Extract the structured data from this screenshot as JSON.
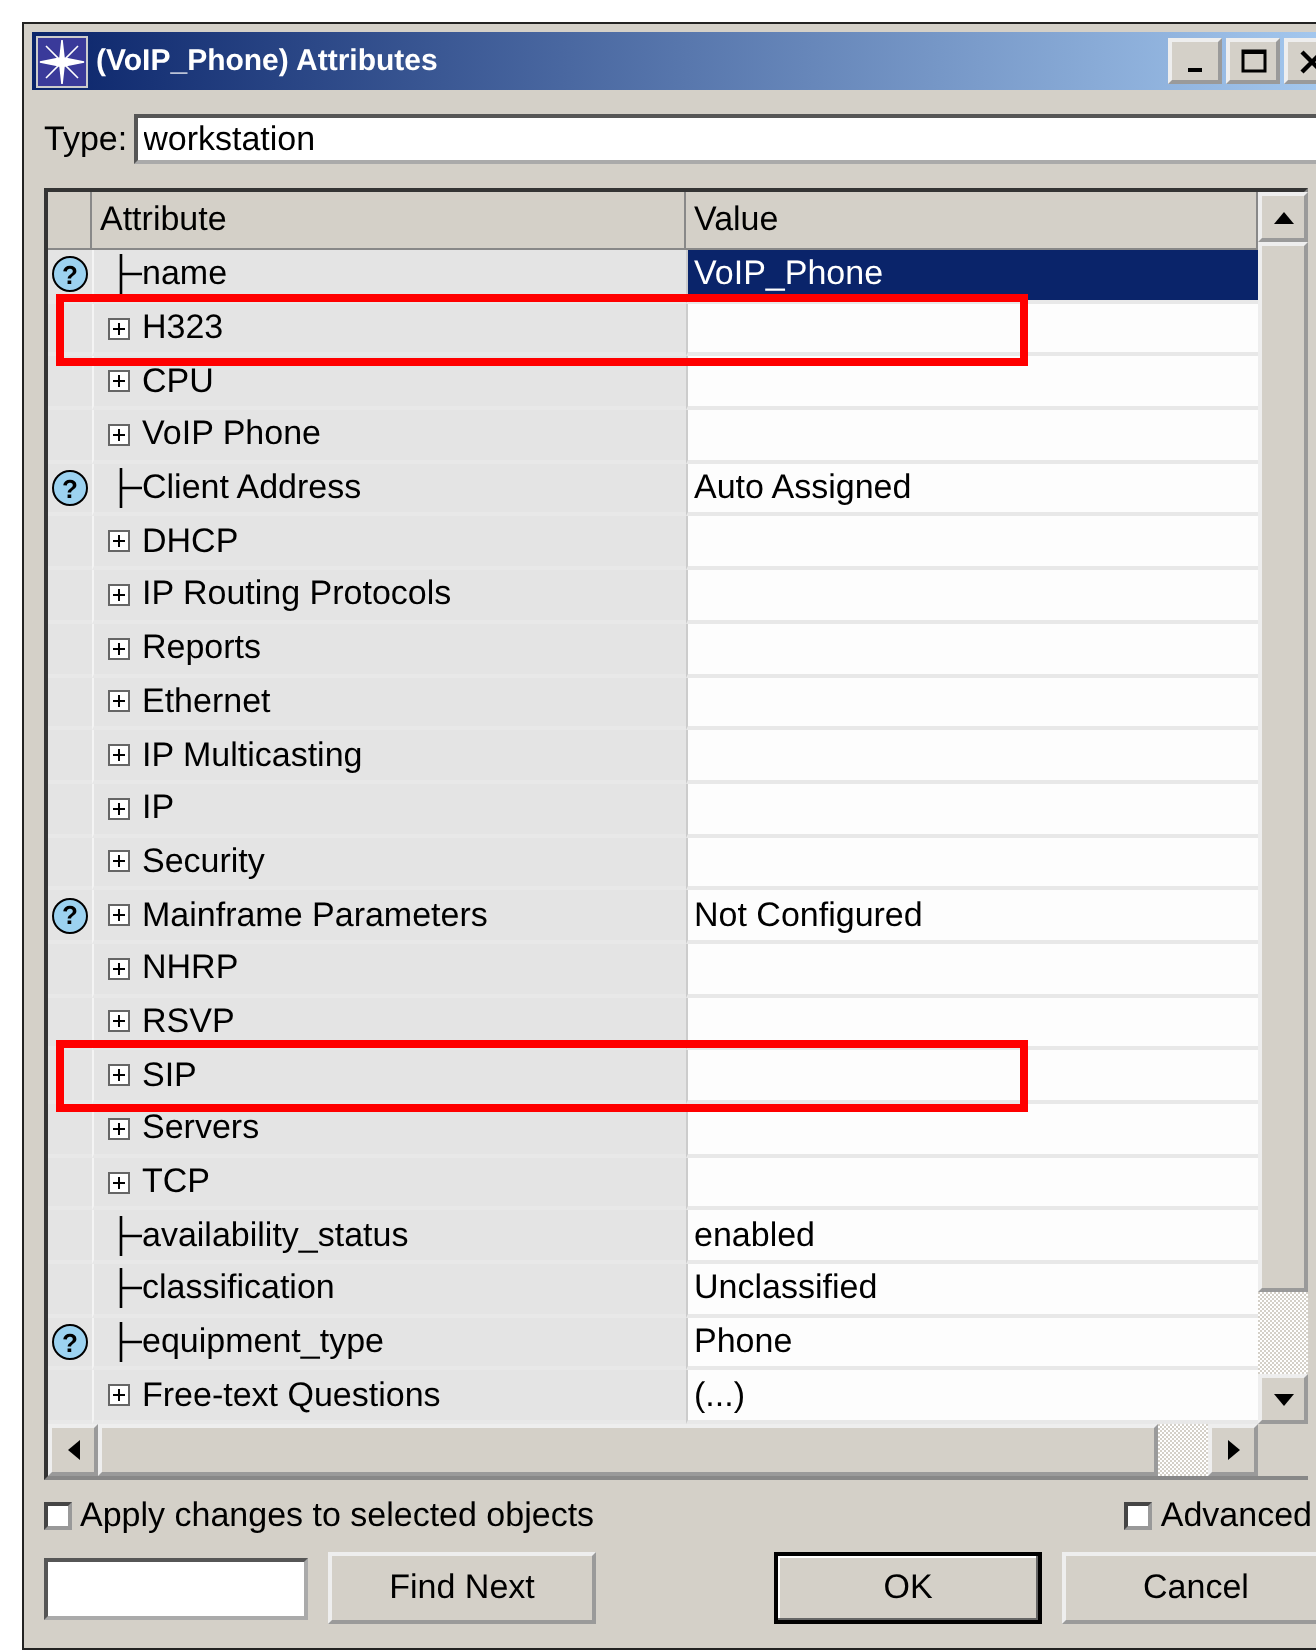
{
  "window": {
    "title": "(VoIP_Phone) Attributes"
  },
  "type_field": {
    "label": "Type:",
    "value": "workstation"
  },
  "table": {
    "columns": [
      "Attribute",
      "Value"
    ],
    "rows": [
      {
        "kind": "leaf",
        "help": "?",
        "attribute": "name",
        "value": "VoIP_Phone",
        "selected": true,
        "highlighted": false
      },
      {
        "kind": "group",
        "attribute": "H323",
        "value": "",
        "selected": false,
        "highlighted": true
      },
      {
        "kind": "group",
        "attribute": "CPU",
        "value": "",
        "selected": false,
        "highlighted": false
      },
      {
        "kind": "group",
        "attribute": "VoIP Phone",
        "value": "",
        "selected": false,
        "highlighted": false
      },
      {
        "kind": "leaf",
        "help": "?",
        "attribute": "Client Address",
        "value": "Auto Assigned",
        "selected": false,
        "highlighted": false
      },
      {
        "kind": "group",
        "attribute": "DHCP",
        "value": "",
        "selected": false,
        "highlighted": false
      },
      {
        "kind": "group",
        "attribute": "IP Routing Protocols",
        "value": "",
        "selected": false,
        "highlighted": false
      },
      {
        "kind": "group",
        "attribute": "Reports",
        "value": "",
        "selected": false,
        "highlighted": false
      },
      {
        "kind": "group",
        "attribute": "Ethernet",
        "value": "",
        "selected": false,
        "highlighted": false
      },
      {
        "kind": "group",
        "attribute": "IP Multicasting",
        "value": "",
        "selected": false,
        "highlighted": false
      },
      {
        "kind": "group",
        "attribute": "IP",
        "value": "",
        "selected": false,
        "highlighted": false
      },
      {
        "kind": "group",
        "attribute": "Security",
        "value": "",
        "selected": false,
        "highlighted": false
      },
      {
        "kind": "group",
        "help": "?",
        "attribute": "Mainframe Parameters",
        "value": "Not Configured",
        "selected": false,
        "highlighted": false
      },
      {
        "kind": "group",
        "attribute": "NHRP",
        "value": "",
        "selected": false,
        "highlighted": false
      },
      {
        "kind": "group",
        "attribute": "RSVP",
        "value": "",
        "selected": false,
        "highlighted": false
      },
      {
        "kind": "group",
        "attribute": "SIP",
        "value": "",
        "selected": false,
        "highlighted": true
      },
      {
        "kind": "group",
        "attribute": "Servers",
        "value": "",
        "selected": false,
        "highlighted": false
      },
      {
        "kind": "group",
        "attribute": "TCP",
        "value": "",
        "selected": false,
        "highlighted": false
      },
      {
        "kind": "leaf",
        "attribute": "availability_status",
        "value": "enabled",
        "selected": false,
        "highlighted": false
      },
      {
        "kind": "leaf",
        "attribute": "classification",
        "value": "Unclassified",
        "selected": false,
        "highlighted": false
      },
      {
        "kind": "leaf",
        "help": "?",
        "attribute": "equipment_type",
        "value": "Phone",
        "selected": false,
        "highlighted": false
      },
      {
        "kind": "group",
        "attribute": "Free-text Questions",
        "value": "(...)",
        "selected": false,
        "highlighted": false
      }
    ]
  },
  "options": [
    {
      "label": "Apply changes to selected objects",
      "checked": false
    },
    {
      "label": "Advanced",
      "checked": false
    }
  ],
  "buttons": [
    "Find Next",
    "OK",
    "Cancel"
  ]
}
